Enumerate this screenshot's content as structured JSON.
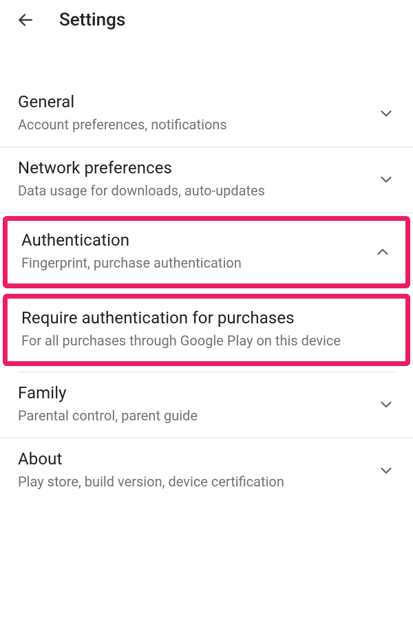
{
  "header": {
    "title": "Settings"
  },
  "sections": {
    "general": {
      "title": "General",
      "subtitle": "Account preferences, notifications"
    },
    "network": {
      "title": "Network preferences",
      "subtitle": "Data usage for downloads, auto-updates"
    },
    "authentication": {
      "title": "Authentication",
      "subtitle": "Fingerprint, purchase authentication"
    },
    "requireAuth": {
      "title": "Require authentication for purchases",
      "subtitle": "For all purchases through Google Play on this device"
    },
    "family": {
      "title": "Family",
      "subtitle": "Parental control, parent guide"
    },
    "about": {
      "title": "About",
      "subtitle": "Play store, build version, device certification"
    }
  }
}
